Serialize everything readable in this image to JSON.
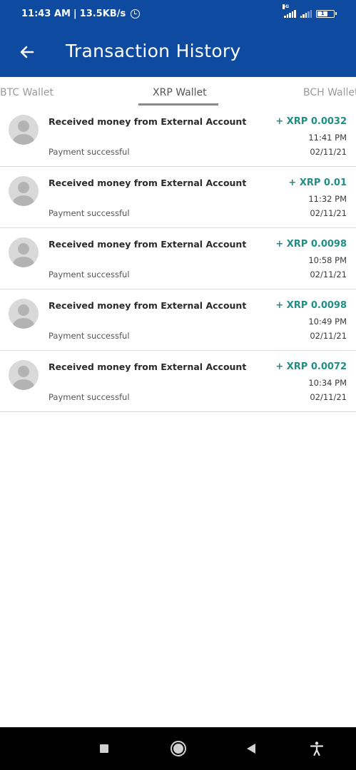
{
  "status_bar": {
    "time": "11:43 AM",
    "net_speed": "13.5KB/s",
    "network_type": "4G",
    "battery_level": "1"
  },
  "header": {
    "title": "Transaction History",
    "back_icon": "arrow-left-icon"
  },
  "tabs": [
    {
      "label": "BTC Wallet",
      "active": false
    },
    {
      "label": "XRP Wallet",
      "active": true
    },
    {
      "label": "BCH Wallet",
      "active": false
    }
  ],
  "transactions": [
    {
      "title": "Received money from External Account",
      "status": "Payment successful",
      "amount": "+ XRP 0.0032",
      "time": "11:41 PM",
      "date": "02/11/21"
    },
    {
      "title": "Received money from External Account",
      "status": "Payment successful",
      "amount": "+ XRP 0.01",
      "time": "11:32 PM",
      "date": "02/11/21"
    },
    {
      "title": "Received money from External Account",
      "status": "Payment successful",
      "amount": "+ XRP 0.0098",
      "time": "10:58 PM",
      "date": "02/11/21"
    },
    {
      "title": "Received money from External Account",
      "status": "Payment successful",
      "amount": "+ XRP 0.0098",
      "time": "10:49 PM",
      "date": "02/11/21"
    },
    {
      "title": "Received money from External Account",
      "status": "Payment successful",
      "amount": "+ XRP 0.0072",
      "time": "10:34 PM",
      "date": "02/11/21"
    }
  ],
  "colors": {
    "primary": "#0e4aa0",
    "amount": "#1f8f86",
    "divider": "#dcdcdc"
  },
  "nav_bar": {
    "icons": [
      "recents-square-icon",
      "home-circle-icon",
      "back-triangle-icon",
      "accessibility-icon"
    ]
  }
}
